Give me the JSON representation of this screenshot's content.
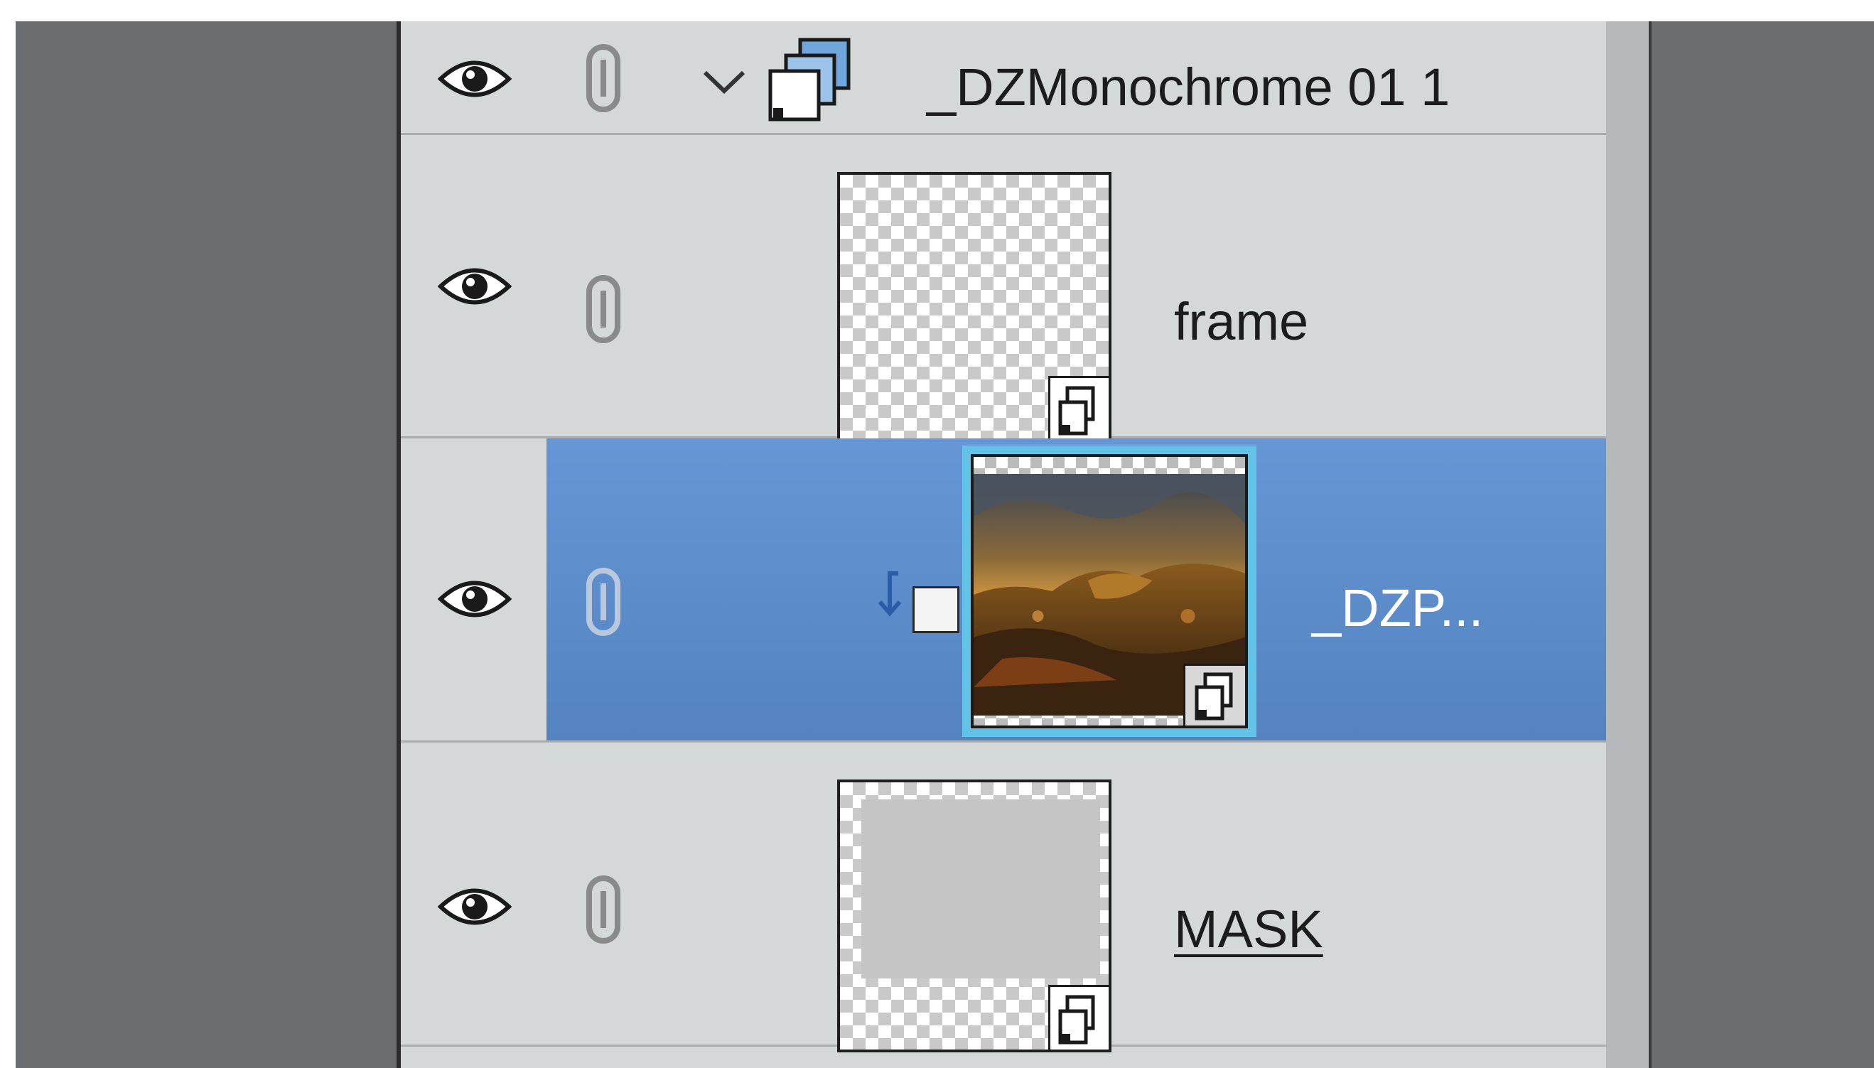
{
  "layers_panel": {
    "group": {
      "name": "_DZMonochrome 01 1",
      "icon": "smart-object-group-icon",
      "expanded": true
    },
    "layers": [
      {
        "name": "frame",
        "type": "smart-object",
        "selected": false,
        "underlined": false
      },
      {
        "name": "_DZP...",
        "type": "smart-object",
        "selected": true,
        "clipped": true,
        "underlined": false
      },
      {
        "name": "MASK",
        "type": "smart-object",
        "selected": false,
        "underlined": true
      }
    ]
  },
  "colors": {
    "selection": "#6796d6",
    "panel_bg": "#d5d8d9",
    "frame_bg": "#6b6e70",
    "thumb_highlight": "#62c3e6"
  }
}
